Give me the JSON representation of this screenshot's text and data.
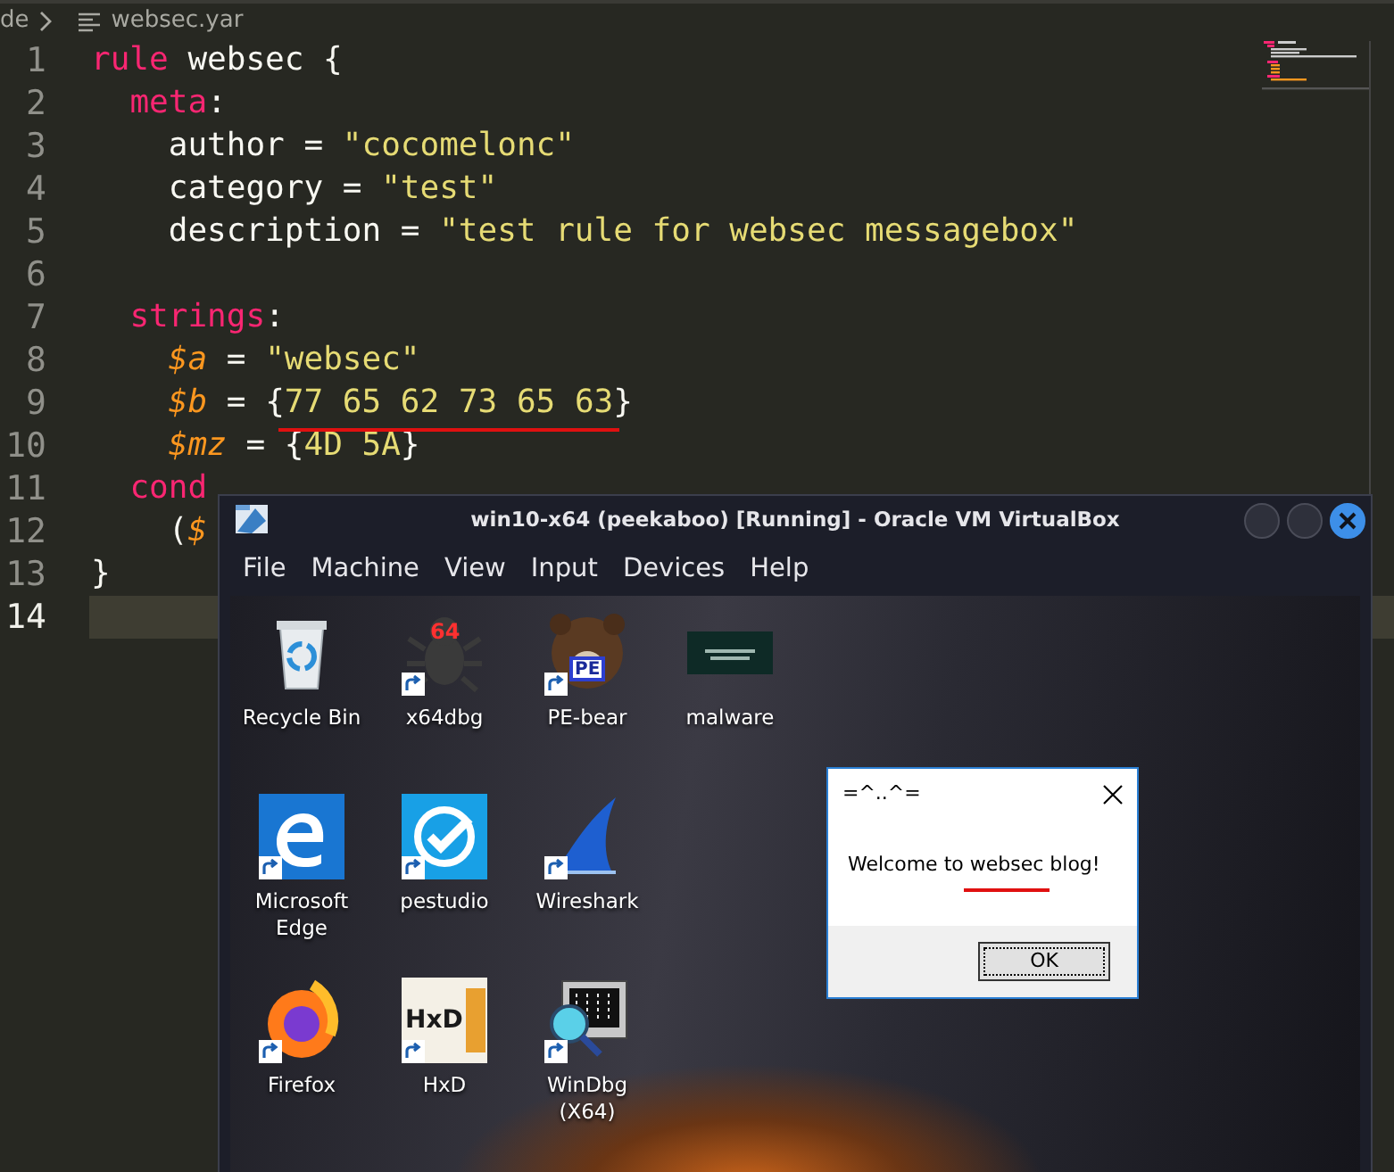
{
  "editor": {
    "breadcrumb": {
      "folder": "de",
      "file": "websec.yar"
    },
    "lines": [
      {
        "number": "1",
        "current": false,
        "tokens": [
          {
            "text": "rule",
            "kind": "keyword"
          },
          {
            "text": " websec {",
            "kind": "plain"
          }
        ]
      },
      {
        "number": "2",
        "current": false,
        "tokens": [
          {
            "text": "  meta",
            "kind": "keyword"
          },
          {
            "text": ":",
            "kind": "plain"
          }
        ]
      },
      {
        "number": "3",
        "current": false,
        "tokens": [
          {
            "text": "    author = ",
            "kind": "plain"
          },
          {
            "text": "\"cocomelonc\"",
            "kind": "string"
          }
        ]
      },
      {
        "number": "4",
        "current": false,
        "tokens": [
          {
            "text": "    category = ",
            "kind": "plain"
          },
          {
            "text": "\"test\"",
            "kind": "string"
          }
        ]
      },
      {
        "number": "5",
        "current": false,
        "tokens": [
          {
            "text": "    description = ",
            "kind": "plain"
          },
          {
            "text": "\"test rule for websec messagebox\"",
            "kind": "string"
          }
        ]
      },
      {
        "number": "6",
        "current": false
      },
      {
        "number": "7",
        "current": false,
        "tokens": [
          {
            "text": "  strings",
            "kind": "keyword"
          },
          {
            "text": ":",
            "kind": "plain"
          }
        ]
      },
      {
        "number": "8",
        "current": false,
        "tokens": [
          {
            "text": "    $a",
            "kind": "variable"
          },
          {
            "text": " = ",
            "kind": "plain"
          },
          {
            "text": "\"websec\"",
            "kind": "string"
          }
        ]
      },
      {
        "number": "9",
        "current": false,
        "tokens": [
          {
            "text": "    $b",
            "kind": "variable"
          },
          {
            "text": " = {",
            "kind": "plain"
          },
          {
            "text": "77 65 62 73 65 63",
            "kind": "string",
            "underlined": true
          },
          {
            "text": "}",
            "kind": "plain"
          }
        ]
      },
      {
        "number": "10",
        "current": false,
        "tokens": [
          {
            "text": "    $mz",
            "kind": "variable"
          },
          {
            "text": " = {",
            "kind": "plain"
          },
          {
            "text": "4D 5A",
            "kind": "string"
          },
          {
            "text": "}",
            "kind": "plain"
          }
        ]
      },
      {
        "number": "11",
        "current": false,
        "tokens": [
          {
            "text": "  cond",
            "kind": "keyword"
          }
        ]
      },
      {
        "number": "12",
        "current": false,
        "tokens": [
          {
            "text": "    (",
            "kind": "plain"
          },
          {
            "text": "$",
            "kind": "variable"
          }
        ]
      },
      {
        "number": "13",
        "current": false,
        "tokens": [
          {
            "text": "}",
            "kind": "plain"
          }
        ]
      },
      {
        "number": "14",
        "current": true
      }
    ]
  },
  "vm_window": {
    "title": "win10-x64 (peekaboo) [Running] - Oracle VM VirtualBox",
    "title_buttons": [
      {
        "kind": "minimize"
      },
      {
        "kind": "maximize"
      },
      {
        "kind": "close"
      }
    ],
    "menu": [
      "File",
      "Machine",
      "View",
      "Input",
      "Devices",
      "Help"
    ],
    "desktop_rows": [
      [
        {
          "label": "Recycle Bin",
          "kind": "recycle",
          "shortcut": false
        },
        {
          "label": "x64dbg",
          "kind": "bug",
          "shortcut": true,
          "icon_text": "64"
        },
        {
          "label": "PE-bear",
          "kind": "bear",
          "shortcut": true,
          "icon_text": "PE"
        },
        {
          "label": "malware",
          "kind": "thumbnail",
          "shortcut": false
        }
      ],
      [
        {
          "label": "Microsoft Edge",
          "kind": "edge",
          "shortcut": true
        },
        {
          "label": "pestudio",
          "kind": "pestudio",
          "shortcut": true
        },
        {
          "label": "Wireshark",
          "kind": "shark",
          "shortcut": true
        }
      ],
      [
        {
          "label": "Firefox",
          "kind": "firefox",
          "shortcut": true
        },
        {
          "label": "HxD",
          "kind": "hxd",
          "shortcut": true,
          "icon_text": "HxD"
        },
        {
          "label": "WinDbg (X64)",
          "kind": "windbg",
          "shortcut": true
        }
      ]
    ],
    "message_box": {
      "title": "=^..^=",
      "message": [
        {
          "text": "Welcome to ",
          "underlined": false
        },
        {
          "text": "websec",
          "underlined": true
        },
        {
          "text": " blog!",
          "underlined": false
        }
      ],
      "button": "OK"
    }
  }
}
